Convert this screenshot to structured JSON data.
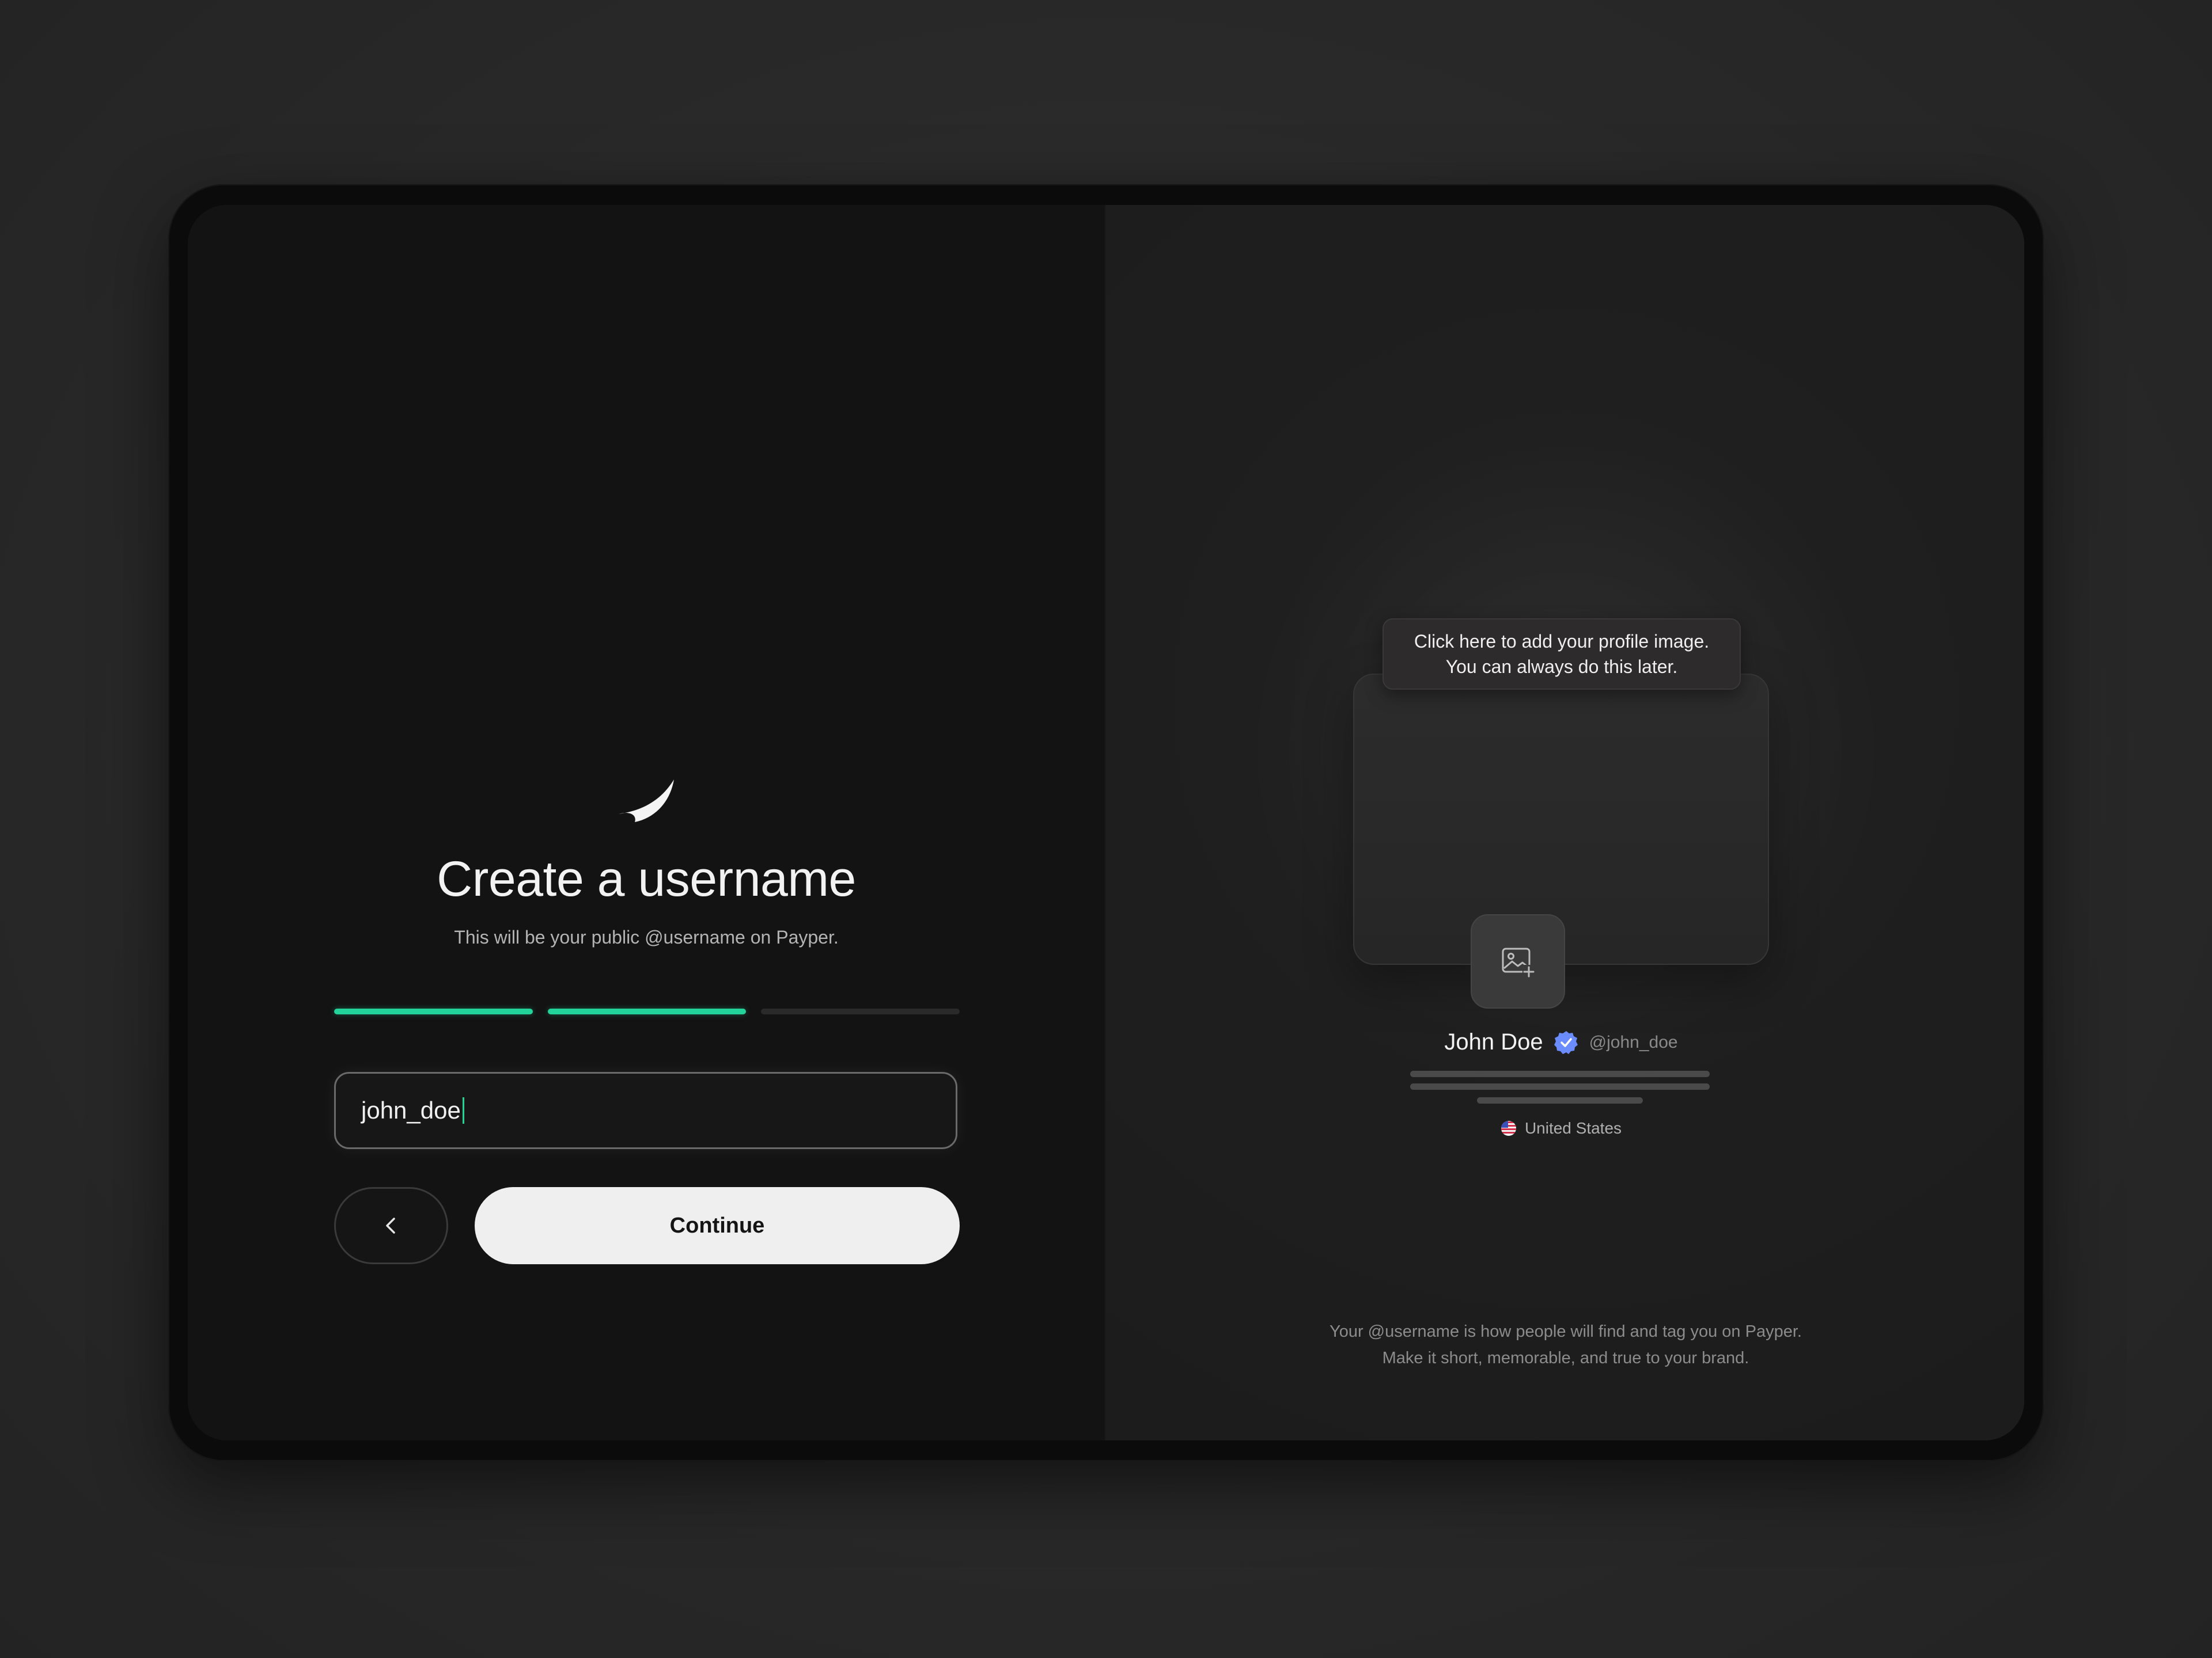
{
  "onboarding": {
    "logo_icon": "leaf-logo-icon",
    "title": "Create a username",
    "subtitle": "This will be your public @username on Payper.",
    "progress": {
      "steps_total": 3,
      "steps_completed": 2,
      "accent_color": "#22d39a"
    },
    "username_input": {
      "value": "john_doe",
      "placeholder": ""
    },
    "back_button": {
      "icon": "chevron-left-icon"
    },
    "continue_button": {
      "label": "Continue"
    }
  },
  "preview": {
    "tooltip_line1": "Click here to add your profile image.",
    "tooltip_line2": "You can always do this later.",
    "avatar_icon": "add-image-icon",
    "name": "John Doe",
    "verified_icon": "verified-badge-icon",
    "verified_color": "#6b8cff",
    "handle": "@john_doe",
    "country_flag_icon": "us-flag-icon",
    "country": "United States",
    "footer_line1": "Your @username is how people will find and tag you on Payper.",
    "footer_line2": "Make it short, memorable, and true to your brand."
  }
}
